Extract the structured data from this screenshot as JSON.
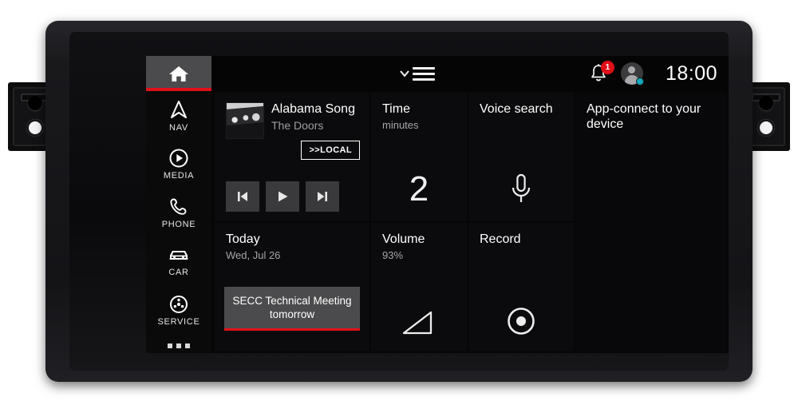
{
  "device": {
    "type": "car-infotainment-head-unit",
    "brackets": [
      "left-mounting-bracket",
      "right-mounting-bracket"
    ]
  },
  "topbar": {
    "menu_icon": "chevron-down-hamburger-icon",
    "notification_icon": "bell-icon",
    "notification_count": "1",
    "avatar_icon": "user-avatar-icon",
    "avatar_status": "online",
    "clock": "18:00"
  },
  "sidebar": {
    "home": {
      "label": "HOME",
      "icon": "home-icon",
      "active": true
    },
    "items": [
      {
        "label": "NAV",
        "icon": "navigation-arrow-icon"
      },
      {
        "label": "MEDIA",
        "icon": "media-play-circle-icon"
      },
      {
        "label": "PHONE",
        "icon": "phone-handset-icon"
      },
      {
        "label": "CAR",
        "icon": "car-icon"
      },
      {
        "label": "SERVICE",
        "icon": "service-wheel-icon"
      }
    ],
    "more_icon": "more-dots-icon"
  },
  "tiles": {
    "media": {
      "name": "media-player-tile",
      "track_title": "Alabama Song",
      "track_artist": "The Doors",
      "album_art": "album-art-thumbnail",
      "source_button": ">>LOCAL",
      "controls": [
        {
          "label": "previous",
          "icon": "skip-previous-icon"
        },
        {
          "label": "play",
          "icon": "play-icon"
        },
        {
          "label": "next",
          "icon": "skip-next-icon"
        }
      ]
    },
    "time": {
      "name": "time-tile",
      "title": "Time",
      "subtitle": "minutes",
      "value": "2"
    },
    "voice": {
      "name": "voice-search-tile",
      "title": "Voice search",
      "icon": "microphone-icon"
    },
    "appconnect": {
      "name": "app-connect-tile",
      "title": "App-connect to your device"
    },
    "calendar": {
      "name": "calendar-tile",
      "title": "Today",
      "subtitle": "Wed, Jul 26",
      "event": "SECC Technical Meeting tomorrow"
    },
    "volume": {
      "name": "volume-tile",
      "title": "Volume",
      "subtitle": "93%",
      "icon": "volume-triangle-icon"
    },
    "record": {
      "name": "record-tile",
      "title": "Record",
      "icon": "record-circle-icon"
    }
  },
  "colors": {
    "accent_red": "#e10f18",
    "screen_bg": "#060607",
    "tile_bg": "#0b0b0d",
    "highlight_gray": "#4b4b4d",
    "status_teal": "#12a8bd"
  }
}
